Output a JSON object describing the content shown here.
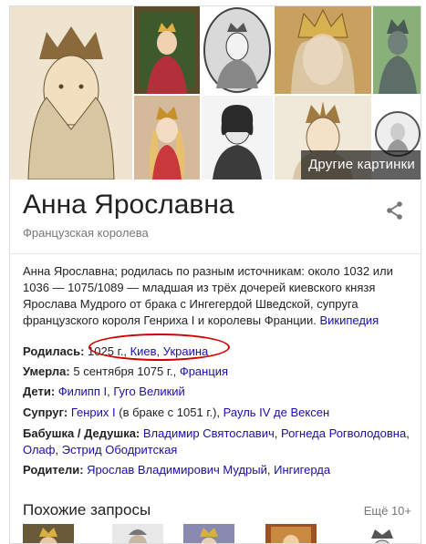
{
  "images_grid": {
    "more_label": "Другие картинки"
  },
  "entity": {
    "name": "Анна Ярославна",
    "subtitle": "Французская королева"
  },
  "description": {
    "text": "Анна Ярославна; родилась по разным источникам: около 1032 или 1036 — 1075/1089 — младшая из трёх дочерей киевского князя Ярослава Мудрого от брака с Ингегердой Шведской, супруга французского короля Генриха I и королевы Франции.",
    "source_link": "Википедия"
  },
  "facts": {
    "born": {
      "label": "Родилась:",
      "value": "1025 г., ",
      "link_city": "Киев",
      "sep": ", ",
      "link_country": "Украина"
    },
    "died": {
      "label": "Умерла:",
      "value": "5 сентября 1075 г., ",
      "link_country": "Франция"
    },
    "children": {
      "label": "Дети:",
      "link1": "Филипп I",
      "sep": ", ",
      "link2": "Гуго Великий"
    },
    "spouse": {
      "label": "Супруг:",
      "link1": "Генрих I",
      "note": " (в браке с 1051 г.), ",
      "link2": "Рауль IV де Вексен"
    },
    "grandparents": {
      "label": "Бабушка / Дедушка:",
      "link1": "Владимир Святославич",
      "link2": "Рогнеда Рогволодовна",
      "link3": "Олаф",
      "link4": "Эстрид Ободритская",
      "sep": ", "
    },
    "parents": {
      "label": "Родители:",
      "link1": "Ярослав Владимирович Мудрый",
      "sep": ", ",
      "link2": "Ингигерда"
    }
  },
  "similar": {
    "heading": "Похожие запросы",
    "more": "Ещё 10+"
  }
}
